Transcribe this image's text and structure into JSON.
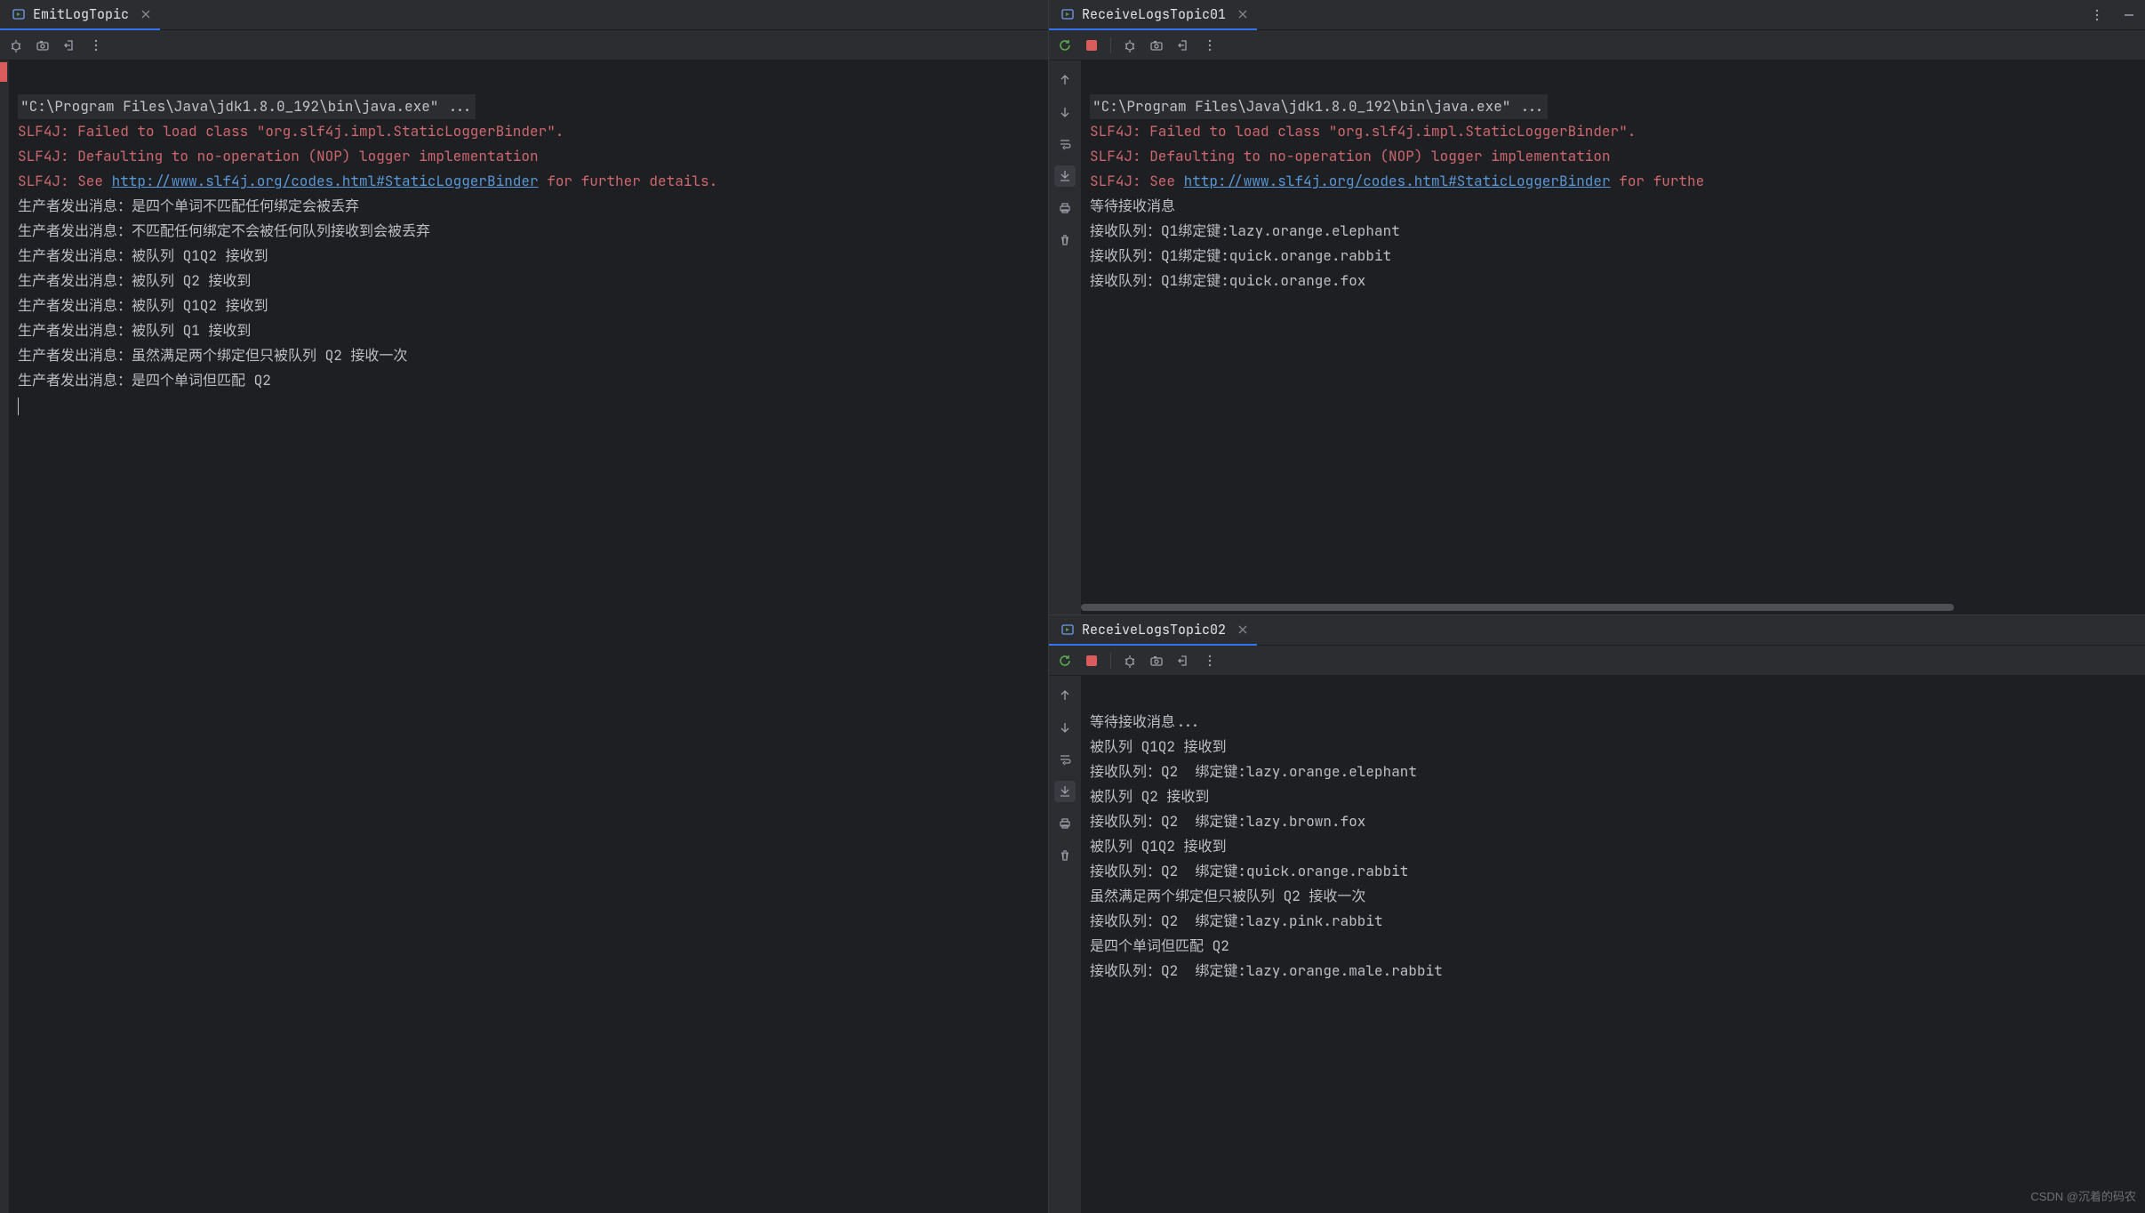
{
  "leftPane": {
    "tabTitle": "EmitLogTopic",
    "cmdLine": "\"C:\\Program Files\\Java\\jdk1.8.0_192\\bin\\java.exe\" ...",
    "slf4j1": "SLF4J: Failed to load class \"org.slf4j.impl.StaticLoggerBinder\".",
    "slf4j2": "SLF4J: Defaulting to no-operation (NOP) logger implementation",
    "slf4j3_prefix": "SLF4J: See ",
    "slf4j3_link": "http://www.slf4j.org/codes.html#StaticLoggerBinder",
    "slf4j3_suffix": " for further details.",
    "lines": [
      "生产者发出消息：是四个单词不匹配任何绑定会被丢弃",
      "生产者发出消息：不匹配任何绑定不会被任何队列接收到会被丢弃",
      "生产者发出消息：被队列 Q1Q2 接收到",
      "生产者发出消息：被队列 Q2 接收到",
      "生产者发出消息：被队列 Q1Q2 接收到",
      "生产者发出消息：被队列 Q1 接收到",
      "生产者发出消息：虽然满足两个绑定但只被队列 Q2 接收一次",
      "生产者发出消息：是四个单词但匹配 Q2"
    ]
  },
  "rightTop": {
    "tabTitle": "ReceiveLogsTopic01",
    "cmdLine": "\"C:\\Program Files\\Java\\jdk1.8.0_192\\bin\\java.exe\" ...",
    "slf4j1": "SLF4J: Failed to load class \"org.slf4j.impl.StaticLoggerBinder\".",
    "slf4j2": "SLF4J: Defaulting to no-operation (NOP) logger implementation",
    "slf4j3_prefix": "SLF4J: See ",
    "slf4j3_link": "http://www.slf4j.org/codes.html#StaticLoggerBinder",
    "slf4j3_suffix": " for furthe",
    "lines": [
      "等待接收消息",
      "接收队列：Q1绑定键:lazy.orange.elephant",
      "接收队列：Q1绑定键:quick.orange.rabbit",
      "接收队列：Q1绑定键:quick.orange.fox"
    ]
  },
  "rightBottom": {
    "tabTitle": "ReceiveLogsTopic02",
    "lines": [
      "等待接收消息...",
      "被队列 Q1Q2 接收到",
      "接收队列：Q2  绑定键:lazy.orange.elephant",
      "被队列 Q2 接收到",
      "接收队列：Q2  绑定键:lazy.brown.fox",
      "被队列 Q1Q2 接收到",
      "接收队列：Q2  绑定键:quick.orange.rabbit",
      "虽然满足两个绑定但只被队列 Q2 接收一次",
      "接收队列：Q2  绑定键:lazy.pink.rabbit",
      "是四个单词但匹配 Q2",
      "接收队列：Q2  绑定键:lazy.orange.male.rabbit"
    ]
  },
  "watermark": "CSDN @沉着的码农"
}
